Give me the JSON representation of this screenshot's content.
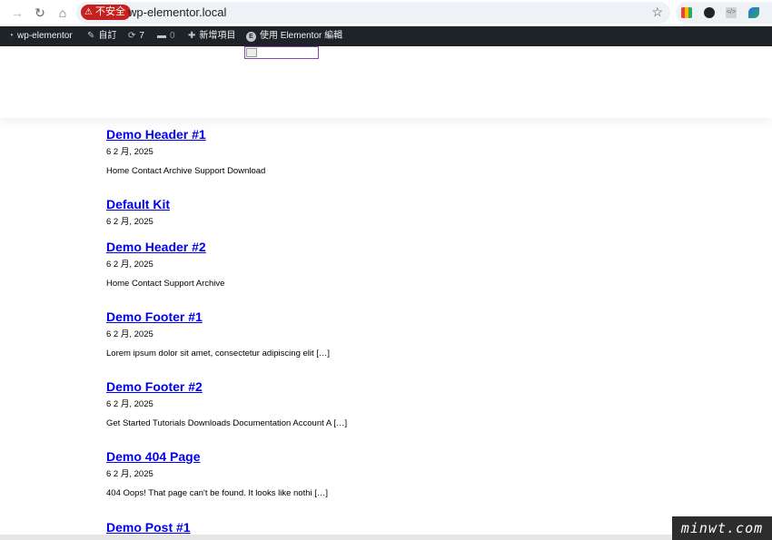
{
  "browser": {
    "security_label": "不安全",
    "url": "wp-elementor.local"
  },
  "adminbar": {
    "site_name": "wp-elementor",
    "customize": "自訂",
    "updates_count": "7",
    "comments_count": "0",
    "new_item": "新增項目",
    "edit_elementor": "使用 Elementor 編輯"
  },
  "posts": [
    {
      "title": "Demo Header #1",
      "date": "6 2 月, 2025",
      "excerpt": "Home Contact Archive Support Download"
    },
    {
      "title": "Default Kit",
      "date": "6 2 月, 2025",
      "excerpt": ""
    },
    {
      "title": "Demo Header #2",
      "date": "6 2 月, 2025",
      "excerpt": "Home Contact Support Archive"
    },
    {
      "title": "Demo Footer #1",
      "date": "6 2 月, 2025",
      "excerpt": "Lorem ipsum dolor sit amet, consectetur adipiscing elit […]"
    },
    {
      "title": "Demo Footer #2",
      "date": "6 2 月, 2025",
      "excerpt": "Get Started Tutorials Downloads Documentation Account A […]"
    },
    {
      "title": "Demo 404 Page",
      "date": "6 2 月, 2025",
      "excerpt": "404 Oops! That page can't be found. It looks like nothi […]"
    },
    {
      "title": "Demo Post #1",
      "date": "",
      "excerpt": ""
    }
  ],
  "watermark": "minwt.com"
}
